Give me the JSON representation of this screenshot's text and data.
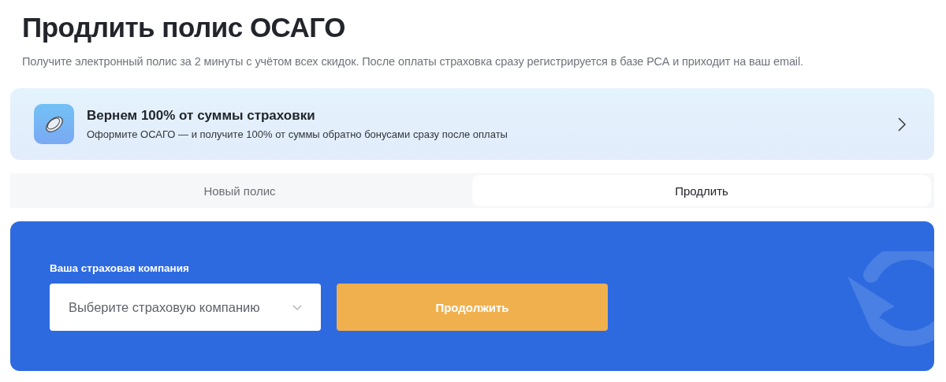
{
  "title": "Продлить полис ОСАГО",
  "subtitle": "Получите электронный полис за 2 минуты с учётом всех скидок. После оплаты страховка сразу регистрируется в базе РСА и приходит на ваш email.",
  "promo": {
    "title": "Вернем 100% от суммы страховки",
    "text": "Оформите ОСАГО — и получите 100% от суммы обратно бонусами сразу после оплаты"
  },
  "tabs": [
    {
      "label": "Новый полис",
      "selected": false
    },
    {
      "label": "Продлить",
      "selected": true
    }
  ],
  "form": {
    "label": "Ваша страховая компания",
    "select": {
      "placeholder": "Выберите страховую компанию"
    },
    "button": "Продолжить"
  }
}
